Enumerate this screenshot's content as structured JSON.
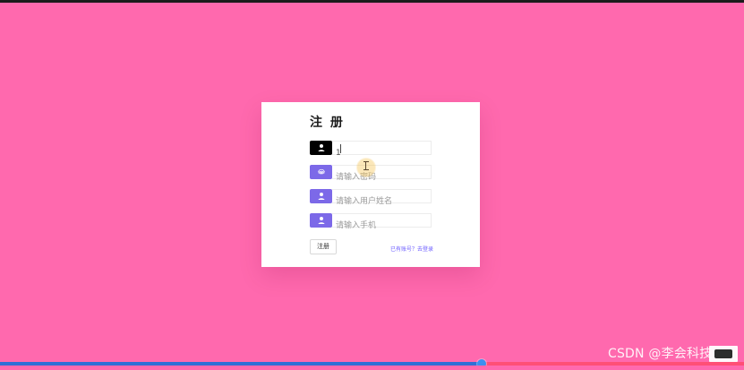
{
  "page": {
    "background_color": "#ff69ae"
  },
  "register_form": {
    "title": "注 册",
    "fields": [
      {
        "name": "username",
        "value": "1",
        "placeholder": "",
        "icon": "user-icon"
      },
      {
        "name": "password",
        "value": "",
        "placeholder": "请输入密码",
        "icon": "fingerprint-icon"
      },
      {
        "name": "realname",
        "value": "",
        "placeholder": "请输入用户姓名",
        "icon": "user-icon"
      },
      {
        "name": "phone",
        "value": "",
        "placeholder": "请输入手机",
        "icon": "user-icon"
      }
    ],
    "submit_label": "注册",
    "login_link_text": "已有账号？去登录"
  },
  "colors": {
    "accent_purple": "#7c69e8",
    "active_icon_bg": "#000000",
    "card_bg": "#ffffff",
    "link_color": "#6f61ff"
  },
  "watermark": {
    "text": "CSDN @李会科技"
  }
}
